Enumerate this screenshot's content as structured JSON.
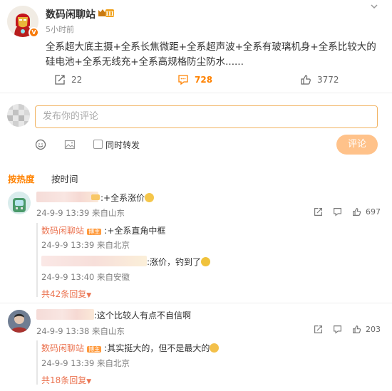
{
  "post": {
    "author": "数码闲聊站",
    "level_badge": "III",
    "verified_badge": "V",
    "time": "5小时前",
    "text": "全系超大底主摄+全系长焦微距+全系超声波+全系有玻璃机身+全系比较大的硅电池+全系无线充+全系高规格防尘防水......",
    "stats": {
      "reposts": "22",
      "comments": "728",
      "likes": "3772"
    }
  },
  "composer": {
    "placeholder": "发布你的评论",
    "repost_checkbox_label": "同时转发",
    "submit_label": "评论"
  },
  "sort_tabs": {
    "hot": "按热度",
    "time": "按时间"
  },
  "comments": [
    {
      "text": ":+全系涨价",
      "meta": "24-9-9 13:39 来自山东",
      "likes": "697",
      "replies": [
        {
          "author": "数码闲聊站",
          "badge": "博主",
          "text": ":+全系直角中框",
          "meta": "24-9-9 13:39 来自北京"
        },
        {
          "author": "",
          "text": ":涨价，钓到了",
          "meta": "24-9-9 13:40 来自安徽"
        }
      ],
      "more_replies": "共42条回复"
    },
    {
      "text": ":这个比较人有点不自信啊",
      "meta": "24-9-9 13:38 来自山东",
      "likes": "203",
      "replies": [
        {
          "author": "数码闲聊站",
          "badge": "博主",
          "text": ":其实挺大的，但不是最大的",
          "meta": "24-9-9 13:39 来自北京"
        }
      ],
      "more_replies": "共18条回复"
    }
  ],
  "colors": {
    "accent": "#ff8200",
    "link": "#eb7350",
    "input_border": "#f1b464",
    "submit_disabled": "#ffc28a"
  },
  "icons": [
    "chevron-down-icon",
    "repost-icon",
    "comment-icon",
    "like-icon",
    "emoji-icon",
    "image-icon",
    "share-icon",
    "reply-icon"
  ]
}
